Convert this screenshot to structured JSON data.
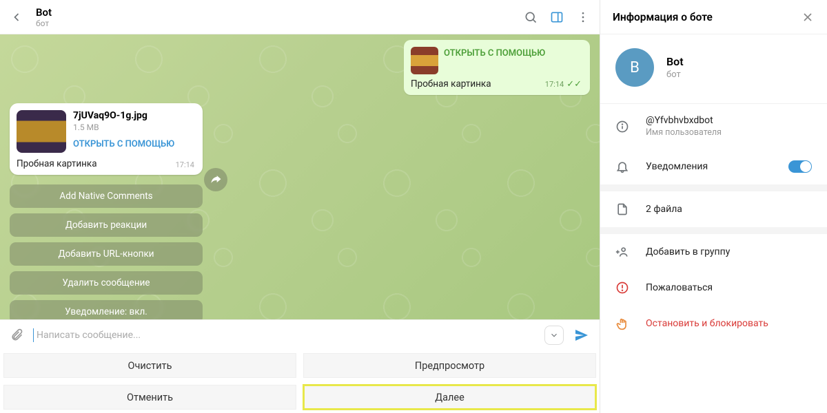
{
  "header": {
    "title": "Bot",
    "subtitle": "бот"
  },
  "messages": {
    "outgoing": {
      "open_label": "ОТКРЫТЬ С ПОМОЩЬЮ",
      "caption": "Пробная картинка",
      "time": "17:14"
    },
    "incoming": {
      "filename": "7jUVaq9O-1g.jpg",
      "filesize": "1.5 MB",
      "open_label": "ОТКРЫТЬ С ПОМОЩЬЮ",
      "caption": "Пробная картинка",
      "time": "17:14"
    }
  },
  "actions": [
    "Add Native Comments",
    "Добавить реакции",
    "Добавить URL-кнопки",
    "Удалить сообщение",
    "Уведомление: вкл."
  ],
  "composer": {
    "placeholder": "Написать сообщение..."
  },
  "footer": {
    "clear": "Очистить",
    "preview": "Предпросмотр",
    "cancel": "Отменить",
    "next": "Далее"
  },
  "info": {
    "header": "Информация о боте",
    "avatar_letter": "B",
    "name": "Bot",
    "subtitle": "бот",
    "username": "@Yfvbhvbxdbot",
    "username_label": "Имя пользователя",
    "notifications": "Уведомления",
    "files": "2 файла",
    "add_group": "Добавить в группу",
    "report": "Пожаловаться",
    "stop": "Остановить и блокировать"
  }
}
